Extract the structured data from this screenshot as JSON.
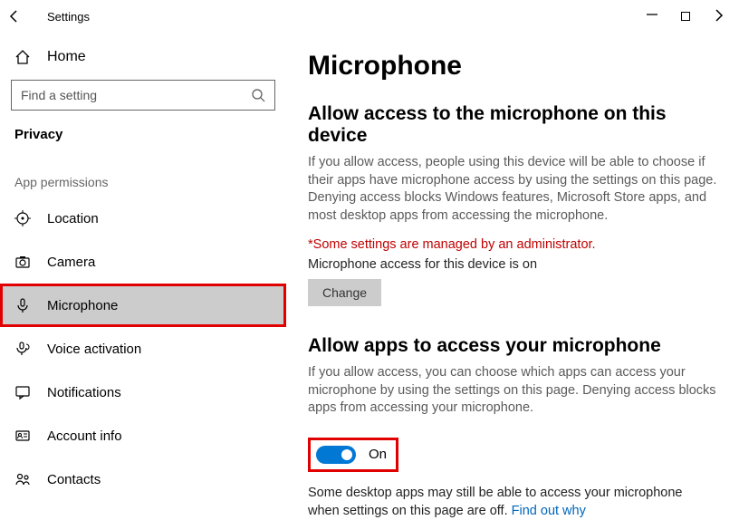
{
  "window": {
    "title": "Settings"
  },
  "sidebar": {
    "home": "Home",
    "search_placeholder": "Find a setting",
    "category": "Privacy",
    "section_label": "App permissions",
    "items": [
      {
        "label": "Location"
      },
      {
        "label": "Camera"
      },
      {
        "label": "Microphone"
      },
      {
        "label": "Voice activation"
      },
      {
        "label": "Notifications"
      },
      {
        "label": "Account info"
      },
      {
        "label": "Contacts"
      }
    ]
  },
  "content": {
    "title": "Microphone",
    "section1": {
      "heading": "Allow access to the microphone on this device",
      "desc": "If you allow access, people using this device will be able to choose if their apps have microphone access by using the settings on this page. Denying access blocks Windows features, Microsoft Store apps, and most desktop apps from accessing the microphone.",
      "warn": "*Some settings are managed by an administrator.",
      "status": "Microphone access for this device is on",
      "button": "Change"
    },
    "section2": {
      "heading": "Allow apps to access your microphone",
      "desc": "If you allow access, you can choose which apps can access your microphone by using the settings on this page. Denying access blocks apps from accessing your microphone.",
      "toggle_label": "On",
      "footnote_text": "Some desktop apps may still be able to access your microphone when settings on this page are off. ",
      "footnote_link": "Find out why"
    }
  }
}
